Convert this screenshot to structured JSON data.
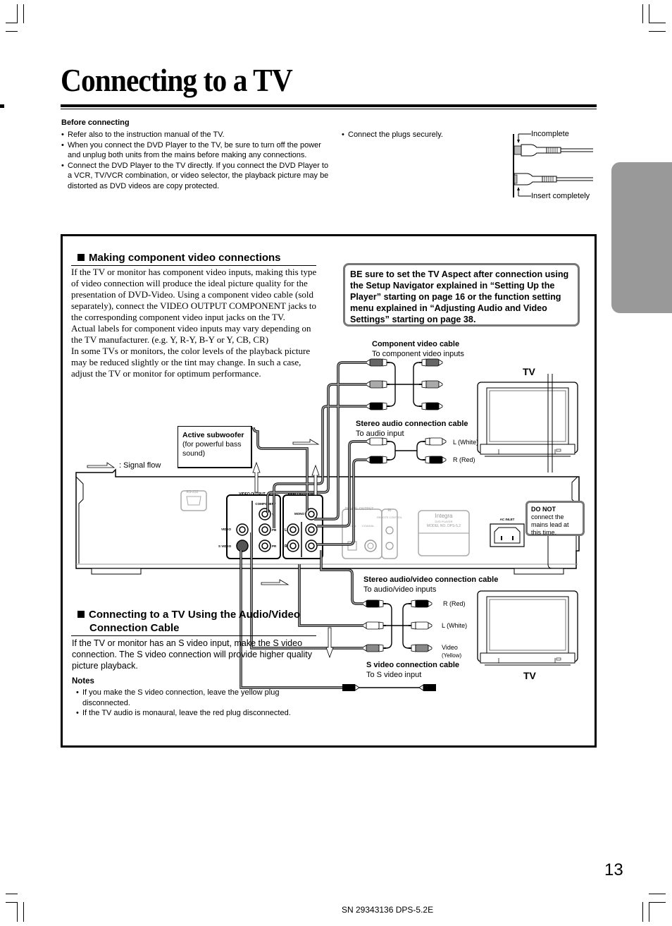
{
  "page": {
    "title": "Connecting to a TV",
    "page_number": "13",
    "footer_code": "SN 29343136 DPS-5.2E"
  },
  "before_connecting": {
    "heading": "Before connecting",
    "items": [
      "Refer also to the instruction manual of the TV.",
      "When you connect the DVD Player to the TV, be sure to turn off the power and unplug both units from the mains before making any connections.",
      "Connect the DVD Player to the TV directly. If you connect the DVD Player to a VCR, TV/VCR combination, or video selector, the playback picture may be distorted as DVD videos are copy protected."
    ],
    "plugs_note": "Connect the plugs securely.",
    "plug_labels": {
      "incomplete": "Incomplete",
      "complete": "Insert completely"
    }
  },
  "component_section": {
    "heading": "Making component video connections",
    "body": [
      "If the TV or monitor has component video inputs, making this type of video connection will produce the ideal picture quality for the presentation of DVD-Video. Using a component video cable (sold separately), connect the VIDEO OUTPUT COMPONENT jacks to the corresponding component video input jacks on the TV.",
      "Actual labels for component video inputs may vary depending on the TV manufacturer. (e.g. Y, R-Y, B-Y or Y, CB, CR)",
      "In some TVs or monitors, the color levels of the playback picture may be reduced slightly or the tint may change. In such a case, adjust the TV or monitor for optimum performance."
    ]
  },
  "aspect_note": "BE sure to set the TV Aspect after connection using the Setup Navigator explained in “Setting Up the Player” starting on page 16 or the function setting menu explained in “Adjusting Audio and Video Settings” starting on page 38.",
  "diagram": {
    "component_cable": {
      "title": "Component video cable",
      "subtitle": "To component video inputs"
    },
    "stereo_cable": {
      "title": "Stereo audio connection cable",
      "subtitle": "To audio input",
      "left": "L (White)",
      "right": "R (Red)"
    },
    "av_cable": {
      "title": "Stereo audio/video connection cable",
      "subtitle": "To audio/video inputs",
      "right": "R (Red)",
      "left": "L (White)",
      "video": "Video",
      "video_color": "(Yellow)"
    },
    "svideo_cable": {
      "title": "S video connection cable",
      "subtitle": "To S video input"
    },
    "tv_label": "TV",
    "subwoofer": {
      "title": "Active subwoofer",
      "desc": "(for powerful bass sound)"
    },
    "signal_flow": ": Signal flow",
    "do_not": {
      "bold": "DO NOT",
      "rest": " connect the mains lead at this time."
    },
    "panel": {
      "rs232": "RS-232",
      "video_output": "VIDEO OUTPUT",
      "component": "COMPONENT",
      "video": "VIDEO",
      "s_video": "S VIDEO",
      "y": "Y",
      "pb": "PB",
      "pr": "PR",
      "analog_output": "ANALOG OUTPUT",
      "mono": "MONO",
      "l": "L",
      "r": "R",
      "digital_output": "DIGITAL OUTPUT",
      "optical": "OPTICAL",
      "coaxial": "COAXIAL",
      "ri": "RI",
      "remote_control": "REMOTE CONTROL",
      "brand": "Integra",
      "product": "DVD PLAYER",
      "model": "MODEL NO. DPS-5.2",
      "ac_inlet": "AC INLET"
    }
  },
  "av_section": {
    "heading_line1": "Connecting to a TV Using the Audio/Video",
    "heading_line2": "Connection Cable",
    "body": "If the TV or monitor has an S video input, make the S video connection. The S video connection will provide higher quality picture playback.",
    "notes_heading": "Notes",
    "notes": [
      "If you make the S video connection, leave the yellow plug disconnected.",
      "If the TV audio is monaural, leave the red plug disconnected."
    ]
  }
}
